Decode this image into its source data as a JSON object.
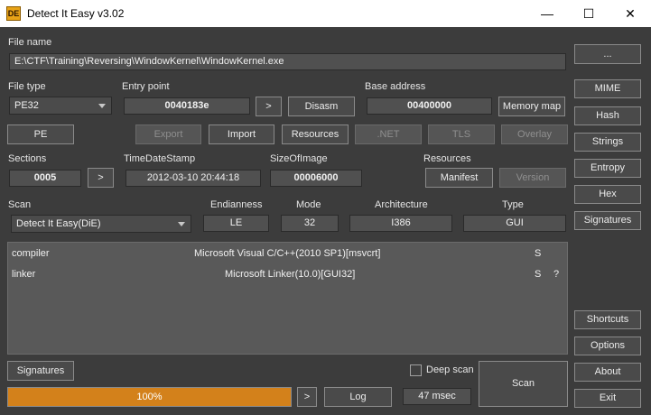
{
  "window": {
    "title": "Detect It Easy v3.02",
    "logo_text": "DE",
    "min": "—",
    "max": "☐",
    "close": "✕"
  },
  "file": {
    "label": "File name",
    "path": "E:\\CTF\\Training\\Reversing\\WindowKernel\\WindowKernel.exe",
    "browse": "..."
  },
  "filetype": {
    "label": "File type",
    "value": "PE32",
    "pe_button": "PE"
  },
  "entry": {
    "label": "Entry point",
    "value": "0040183e",
    "go": ">",
    "disasm": "Disasm"
  },
  "base": {
    "label": "Base address",
    "value": "00400000",
    "memory_map": "Memory map"
  },
  "actions": {
    "export": "Export",
    "import": "Import",
    "resources": "Resources",
    "net": ".NET",
    "tls": "TLS",
    "overlay": "Overlay"
  },
  "sections": {
    "label": "Sections",
    "value": "0005",
    "go": ">"
  },
  "timestamp": {
    "label": "TimeDateStamp",
    "value": "2012-03-10 20:44:18"
  },
  "sizeofimage": {
    "label": "SizeOfImage",
    "value": "00006000"
  },
  "resources": {
    "label": "Resources",
    "manifest": "Manifest",
    "version": "Version"
  },
  "scan": {
    "label": "Scan",
    "value": "Detect It Easy(DiE)"
  },
  "endianness": {
    "label": "Endianness",
    "value": "LE"
  },
  "mode": {
    "label": "Mode",
    "value": "32"
  },
  "architecture": {
    "label": "Architecture",
    "value": "I386"
  },
  "type": {
    "label": "Type",
    "value": "GUI"
  },
  "results": [
    {
      "kind": "compiler",
      "name": "Microsoft Visual C/C++(2010 SP1)[msvcrt]",
      "s": "S",
      "q": ""
    },
    {
      "kind": "linker",
      "name": "Microsoft Linker(10.0)[GUI32]",
      "s": "S",
      "q": "?"
    }
  ],
  "right_buttons": {
    "mime": "MIME",
    "hash": "Hash",
    "strings": "Strings",
    "entropy": "Entropy",
    "hex": "Hex",
    "signatures": "Signatures",
    "shortcuts": "Shortcuts",
    "options": "Options",
    "about": "About",
    "exit": "Exit"
  },
  "bottom": {
    "signatures": "Signatures",
    "deep_scan": "Deep scan",
    "progress": "100%",
    "progress_fraction": 1.0,
    "go": ">",
    "log": "Log",
    "time": "47 msec",
    "scan": "Scan"
  },
  "colors": {
    "background": "#3c3c3c",
    "progress": "#d3811b"
  }
}
